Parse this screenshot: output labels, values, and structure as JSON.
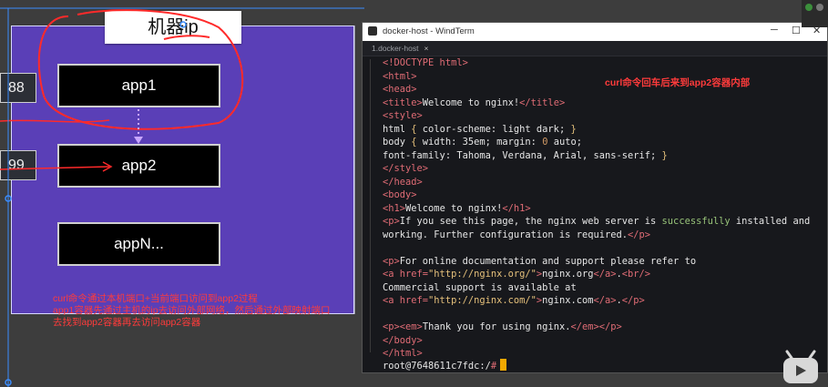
{
  "diagram": {
    "machine_title": "机器ip",
    "apps": [
      "app1",
      "app2",
      "appN..."
    ],
    "ports": [
      "88",
      "99"
    ],
    "notes": [
      "curl命令通过本机端口+当前端口访问到app2过程",
      "app1容器先通过主机的ip去访问外部网络，然后通过外部映射端口",
      "去找到app2容器再去访问app2容器"
    ]
  },
  "terminal": {
    "window_title": "docker-host - WindTerm",
    "tab_label": "1.docker-host",
    "tab_close": "×",
    "annotation": "curl命令回车后来到app2容器内部",
    "lines": {
      "l1": "<!DOCTYPE html>",
      "l2": "<html>",
      "l3": "<head>",
      "l4a": "<title>",
      "l4b": "Welcome to nginx!",
      "l4c": "</title>",
      "l5": "<style>",
      "l6a": "html ",
      "l6b": "{",
      "l6c": " color-scheme: light dark; ",
      "l6d": "}",
      "l7a": "body ",
      "l7b": "{",
      "l7c": " width: 35em; margin: ",
      "l7d": "0",
      "l7e": " auto;",
      "l8a": "font-family: Tahoma, Verdana, Arial, sans-serif; ",
      "l8b": "}",
      "l9": "</style>",
      "l10": "</head>",
      "l11": "<body>",
      "l12a": "<h1>",
      "l12b": "Welcome to nginx!",
      "l12c": "</h1>",
      "l13a": "<p>",
      "l13b": "If you see this page, the nginx web server is ",
      "l13c": "successfully",
      "l13d": " installed and",
      "l14a": "working. Further configuration is required.",
      "l14b": "</p>",
      "l15a": "<p>",
      "l15b": "For online documentation and support please refer to",
      "l16a": "<a href=",
      "l16b": "\"http://nginx.org/\"",
      "l16c": ">",
      "l16d": "nginx.org",
      "l16e": "</a>",
      "l16f": ".",
      "l16g": "<br/>",
      "l17": "Commercial support is available at",
      "l18a": "<a href=",
      "l18b": "\"http://nginx.com/\"",
      "l18c": ">",
      "l18d": "nginx.com",
      "l18e": "</a>",
      "l18f": ".",
      "l18g": "</p>",
      "l19a": "<p>",
      "l19b": "<em>",
      "l19c": "Thank you for using nginx.",
      "l19d": "</em>",
      "l19e": "</p>",
      "l20": "</body>",
      "l21": "</html>"
    },
    "prompt_text": "root@7648611c7fdc:/",
    "prompt_symbol": "#"
  },
  "colors": {
    "machine_bg": "#5a3fb7",
    "annotation": "#ff3b3b",
    "tag": "#e06c75",
    "string": "#e5c07b",
    "success": "#98c379",
    "cursor": "#f1a800"
  }
}
